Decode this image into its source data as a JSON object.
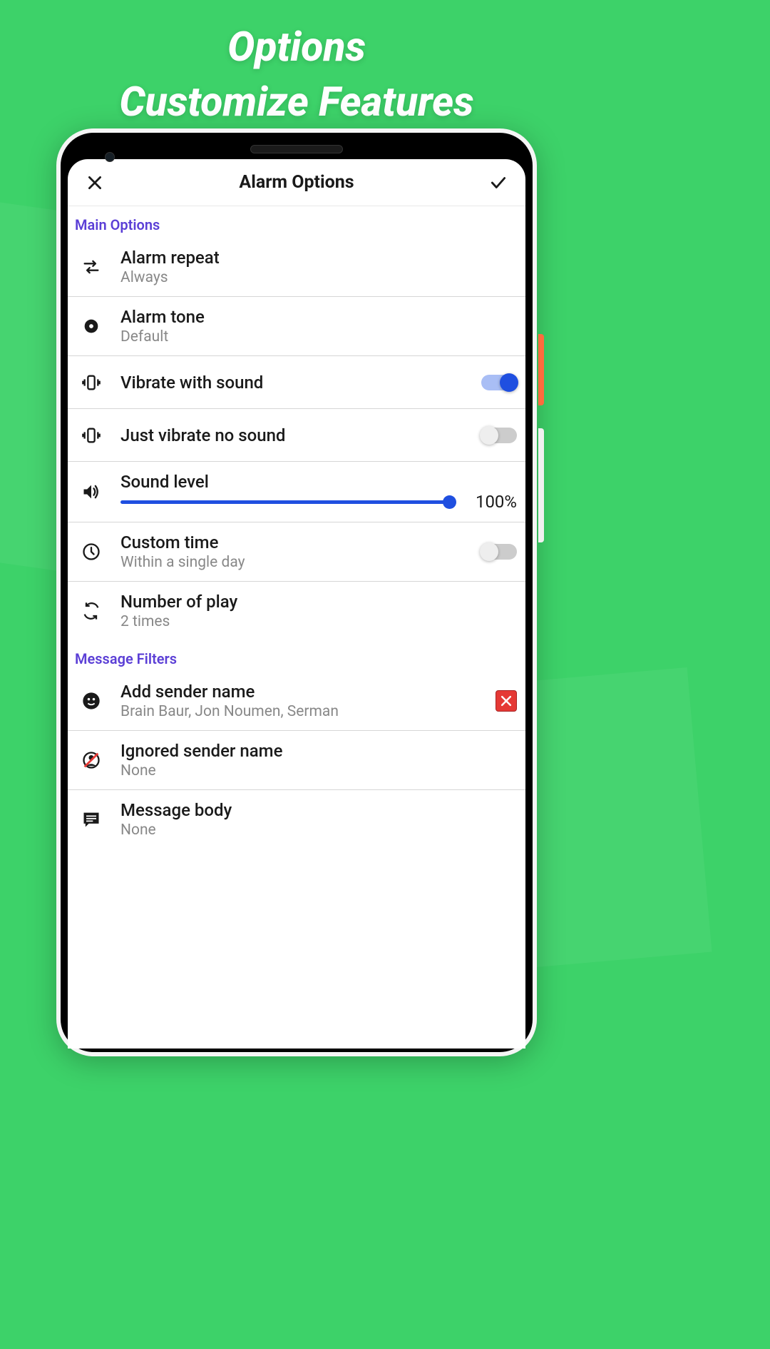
{
  "heading": {
    "line1": "Options",
    "line2": "Customize Features"
  },
  "header": {
    "title": "Alarm Options"
  },
  "sections": {
    "main": "Main Options",
    "filters": "Message Filters"
  },
  "items": {
    "repeat": {
      "title": "Alarm repeat",
      "sub": "Always"
    },
    "tone": {
      "title": "Alarm tone",
      "sub": "Default"
    },
    "vibrate_sound": {
      "title": "Vibrate with sound",
      "on": true
    },
    "just_vibrate": {
      "title": "Just vibrate no sound",
      "on": false
    },
    "sound_level": {
      "title": "Sound level",
      "value": "100%"
    },
    "custom_time": {
      "title": "Custom time",
      "sub": "Within a single day",
      "on": false
    },
    "play_count": {
      "title": "Number of play",
      "sub": "2 times"
    },
    "add_sender": {
      "title": "Add sender name",
      "sub": "Brain Baur, Jon Noumen, Serman"
    },
    "ignored_sender": {
      "title": "Ignored sender name",
      "sub": "None"
    },
    "message_body": {
      "title": "Message body",
      "sub": "None"
    }
  }
}
